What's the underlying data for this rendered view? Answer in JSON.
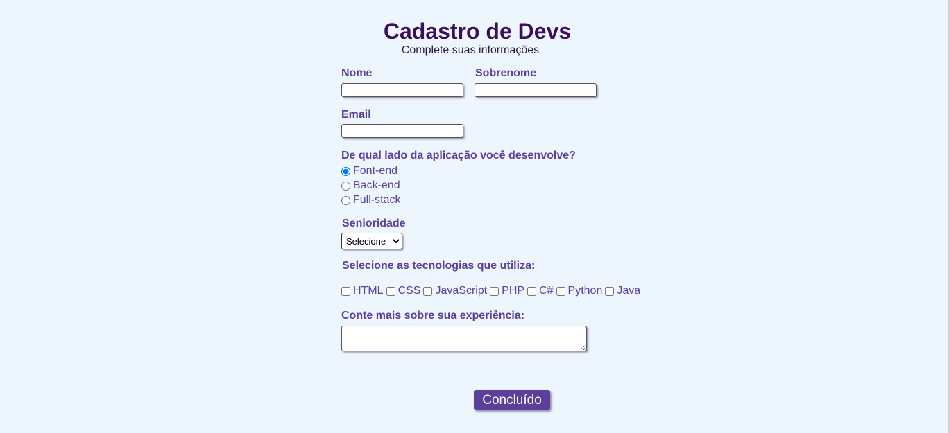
{
  "header": {
    "title": "Cadastro de Devs",
    "subtitle": "Complete suas informações"
  },
  "form": {
    "nome": {
      "label": "Nome",
      "value": ""
    },
    "sobrenome": {
      "label": "Sobrenome",
      "value": ""
    },
    "email": {
      "label": "Email",
      "value": ""
    },
    "lado": {
      "question": "De qual lado da aplicação você desenvolve?",
      "options": [
        "Font-end",
        "Back-end",
        "Full-stack"
      ],
      "selected": "Font-end"
    },
    "senioridade": {
      "label": "Senioridade",
      "selected": "Selecione"
    },
    "tecnologias": {
      "label": "Selecione as tecnologias que utiliza:",
      "options": [
        "HTML",
        "CSS",
        "JavaScript",
        "PHP",
        "C#",
        "Python",
        "Java"
      ]
    },
    "experiencia": {
      "label": "Conte mais sobre sua experiência:",
      "value": ""
    },
    "submit_label": "Concluído"
  },
  "colors": {
    "background": "#eef6fd",
    "title": "#3a0f5c",
    "accent": "#5a3f9b"
  }
}
